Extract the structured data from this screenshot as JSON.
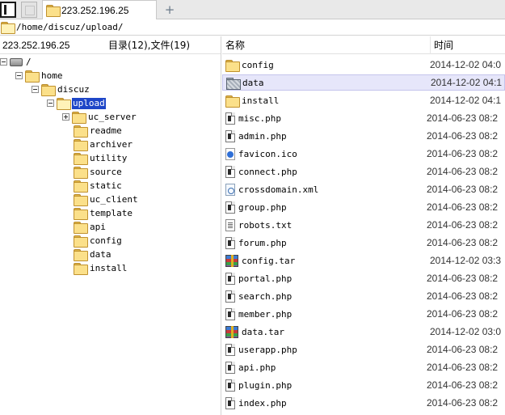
{
  "tab": {
    "title": "223.252.196.25"
  },
  "path": {
    "text": "/home/discuz/upload/"
  },
  "left": {
    "host": "223.252.196.25",
    "counts": "目录(12),文件(19)"
  },
  "tree": [
    {
      "label": "/",
      "icon": "drive-icon",
      "expander": "minus"
    },
    {
      "label": "home",
      "icon": "folder-icon",
      "expander": "minus"
    },
    {
      "label": "discuz",
      "icon": "folder-icon",
      "expander": "minus"
    },
    {
      "label": "upload",
      "icon": "open-folder-icon",
      "expander": "minus",
      "selected": true
    },
    {
      "label": "uc_server",
      "icon": "folder-icon",
      "expander": "plus"
    },
    {
      "label": "readme",
      "icon": "folder-icon"
    },
    {
      "label": "archiver",
      "icon": "folder-icon"
    },
    {
      "label": "utility",
      "icon": "folder-icon"
    },
    {
      "label": "source",
      "icon": "folder-icon"
    },
    {
      "label": "static",
      "icon": "folder-icon"
    },
    {
      "label": "uc_client",
      "icon": "folder-icon"
    },
    {
      "label": "template",
      "icon": "folder-icon"
    },
    {
      "label": "api",
      "icon": "folder-icon"
    },
    {
      "label": "config",
      "icon": "folder-icon"
    },
    {
      "label": "data",
      "icon": "folder-icon"
    },
    {
      "label": "install",
      "icon": "folder-icon"
    }
  ],
  "columns": {
    "name": "名称",
    "time": "时间"
  },
  "files": [
    {
      "name": "config",
      "icon": "folder-icon",
      "time": "2014-12-02 04:0"
    },
    {
      "name": "data",
      "icon": "data-folder-icon",
      "time": "2014-12-02 04:1",
      "selected": true
    },
    {
      "name": "install",
      "icon": "folder-icon",
      "time": "2014-12-02 04:1"
    },
    {
      "name": "misc.php",
      "icon": "php-file-icon",
      "time": "2014-06-23 08:2"
    },
    {
      "name": "admin.php",
      "icon": "php-file-icon",
      "time": "2014-06-23 08:2"
    },
    {
      "name": "favicon.ico",
      "icon": "ico-file-icon",
      "time": "2014-06-23 08:2"
    },
    {
      "name": "connect.php",
      "icon": "php-file-icon",
      "time": "2014-06-23 08:2"
    },
    {
      "name": "crossdomain.xml",
      "icon": "xml-file-icon",
      "time": "2014-06-23 08:2"
    },
    {
      "name": "group.php",
      "icon": "php-file-icon",
      "time": "2014-06-23 08:2"
    },
    {
      "name": "robots.txt",
      "icon": "txt-file-icon",
      "time": "2014-06-23 08:2"
    },
    {
      "name": "forum.php",
      "icon": "php-file-icon",
      "time": "2014-06-23 08:2"
    },
    {
      "name": "config.tar",
      "icon": "archive-icon",
      "time": "2014-12-02 03:3"
    },
    {
      "name": "portal.php",
      "icon": "php-file-icon",
      "time": "2014-06-23 08:2"
    },
    {
      "name": "search.php",
      "icon": "php-file-icon",
      "time": "2014-06-23 08:2"
    },
    {
      "name": "member.php",
      "icon": "php-file-icon",
      "time": "2014-06-23 08:2"
    },
    {
      "name": "data.tar",
      "icon": "archive-icon",
      "time": "2014-12-02 03:0"
    },
    {
      "name": "userapp.php",
      "icon": "php-file-icon",
      "time": "2014-06-23 08:2"
    },
    {
      "name": "api.php",
      "icon": "php-file-icon",
      "time": "2014-06-23 08:2"
    },
    {
      "name": "plugin.php",
      "icon": "php-file-icon",
      "time": "2014-06-23 08:2"
    },
    {
      "name": "index.php",
      "icon": "php-file-icon",
      "time": "2014-06-23 08:2"
    }
  ]
}
